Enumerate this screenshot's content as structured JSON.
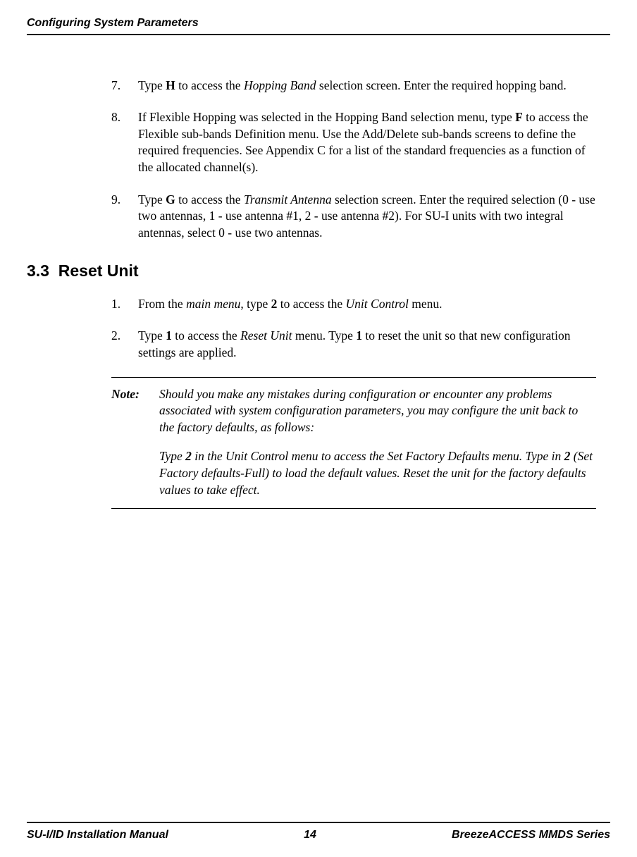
{
  "header": {
    "title": "Configuring System Parameters"
  },
  "list_top": [
    {
      "num": "7.",
      "html": "Type <b>H</b> to access the <i>Hopping Band</i> selection screen. Enter the required hopping band."
    },
    {
      "num": "8.",
      "html": "If Flexible Hopping was selected in the Hopping Band selection menu, type <b>F</b> to access the Flexible sub-bands Definition menu. Use the Add/Delete sub-bands screens to define the required frequencies. See Appendix C for a list of the standard frequencies as a function of the allocated channel(s)."
    },
    {
      "num": "9.",
      "html": "Type <b>G</b> to access the <i>Transmit Antenna</i> selection screen. Enter the required selection (0 - use two antennas, 1 - use antenna #1, 2 - use antenna #2). For SU-I units with two integral antennas, select 0 - use two antennas."
    }
  ],
  "section": {
    "number": "3.3",
    "title": "Reset Unit"
  },
  "list_bottom": [
    {
      "num": "1.",
      "html": "From the <i>main menu</i>, type <b>2</b> to access the <i>Unit Control</i> menu."
    },
    {
      "num": "2.",
      "html": "Type <b>1</b> to access the <i>Reset Unit</i> menu. Type <b>1</b> to reset the unit so that new configuration settings are applied."
    }
  ],
  "note": {
    "label": "Note:",
    "paragraphs": [
      "Should you make any mistakes during configuration or encounter any problems associated with system configuration parameters, you may configure the unit back to the factory defaults, as follows:",
      "Type <b>2</b> in the Unit Control menu to access the Set Factory Defaults menu. Type in <b>2</b> (Set Factory defaults-Full) to load the default values. Reset the unit for the factory defaults values to take effect."
    ]
  },
  "footer": {
    "left": "SU-I/ID Installation Manual",
    "center": "14",
    "right": "BreezeACCESS MMDS Series"
  }
}
